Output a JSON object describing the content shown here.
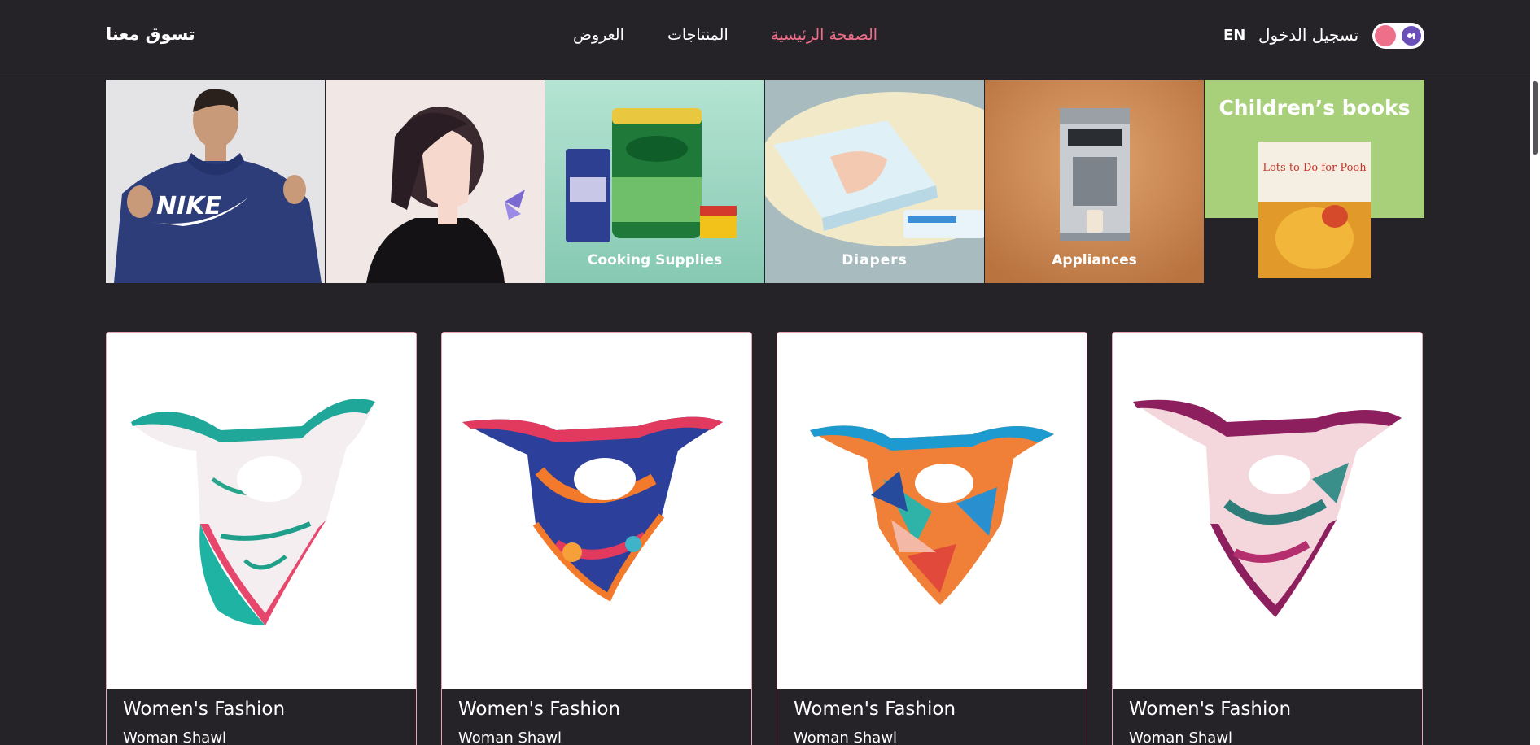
{
  "header": {
    "brand": "تسوق معنا",
    "nav": {
      "home": "الصفحة الرئيسية",
      "products": "المنتاجات",
      "offers": "العروض"
    },
    "login": "تسجيل الدخول",
    "language": "EN",
    "theme_toggle_icons": [
      "sun-icon",
      "moon-icon"
    ]
  },
  "categories": [
    {
      "label": "",
      "icon": "nike-hoodie-image"
    },
    {
      "label": "",
      "icon": "anime-girl-image"
    },
    {
      "label": "Cooking Supplies",
      "icon": "grocery-image"
    },
    {
      "label": "Diapers",
      "icon": "diapers-image"
    },
    {
      "label": "Appliances",
      "icon": "coffee-machine-image"
    },
    {
      "label": "Children’s books",
      "icon": "book-image"
    }
  ],
  "category_book_text": "Lots to Do for Pooh",
  "nike_text": "NIKE",
  "products": [
    {
      "category": "Women's Fashion",
      "title": "Woman Shawl"
    },
    {
      "category": "Women's Fashion",
      "title": "Woman Shawl"
    },
    {
      "category": "Women's Fashion",
      "title": "Woman Shawl"
    },
    {
      "category": "Women's Fashion",
      "title": "Woman Shawl"
    }
  ],
  "colors": {
    "background": "#252328",
    "accent": "#ee6f89",
    "card_border": "#e7a5b3",
    "toggle_moon": "#6a4fb8"
  }
}
